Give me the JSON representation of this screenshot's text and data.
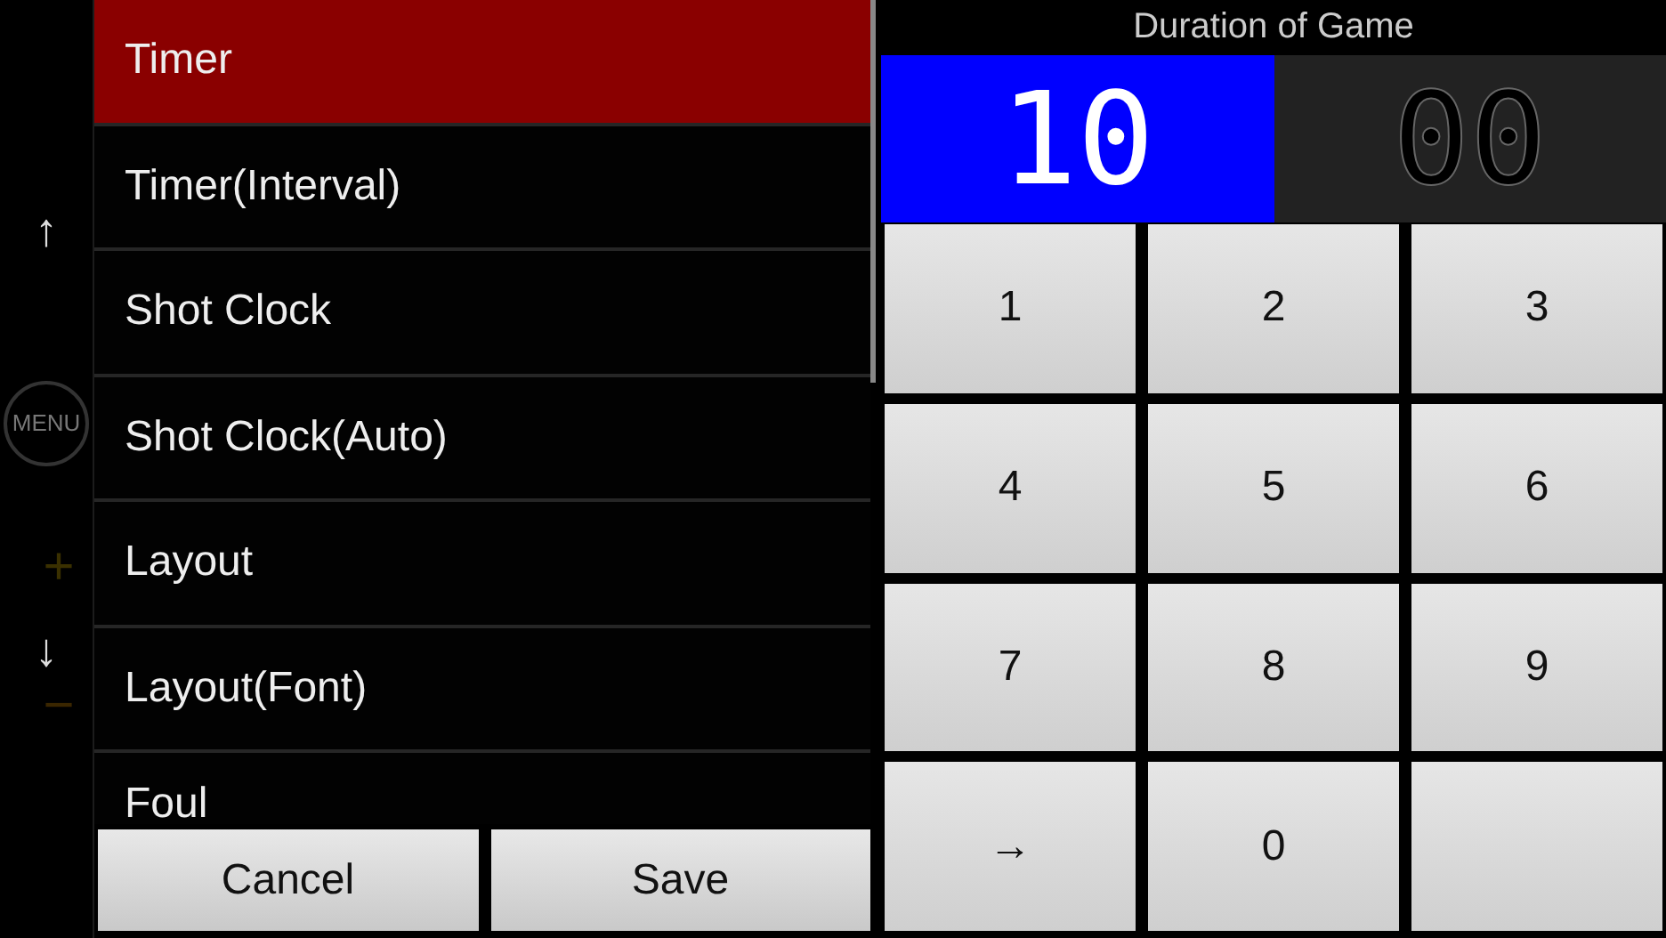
{
  "side_strip": [
    {
      "label": "↑"
    },
    {
      "label": "MENU"
    },
    {
      "label": "+"
    },
    {
      "label": "↓"
    },
    {
      "label": "−"
    }
  ],
  "menu": {
    "items": [
      {
        "label": "Timer",
        "selected": true
      },
      {
        "label": "Timer(Interval)",
        "selected": false
      },
      {
        "label": "Shot Clock",
        "selected": false
      },
      {
        "label": "Shot Clock(Auto)",
        "selected": false
      },
      {
        "label": "Layout",
        "selected": false
      },
      {
        "label": "Layout(Font)",
        "selected": false
      },
      {
        "label": "Foul",
        "selected": false
      }
    ],
    "buttons": [
      "Cancel",
      "Save"
    ]
  },
  "dialog": {
    "title": "Duration of Game",
    "fields": [
      {
        "value": "10",
        "selected": true
      },
      {
        "value": "00",
        "selected": false
      }
    ],
    "keys": [
      {
        "kind": "key",
        "label": "1"
      },
      {
        "kind": "key",
        "label": "2"
      },
      {
        "kind": "key",
        "label": "3"
      },
      {
        "kind": "key",
        "label": "4"
      },
      {
        "kind": "key",
        "label": "5"
      },
      {
        "kind": "key",
        "label": "6"
      },
      {
        "kind": "key",
        "label": "7"
      },
      {
        "kind": "key",
        "label": "8"
      },
      {
        "kind": "key",
        "label": "9"
      },
      {
        "kind": "key",
        "label": "→"
      },
      {
        "kind": "key",
        "label": "0"
      },
      {
        "kind": "blank"
      }
    ]
  }
}
